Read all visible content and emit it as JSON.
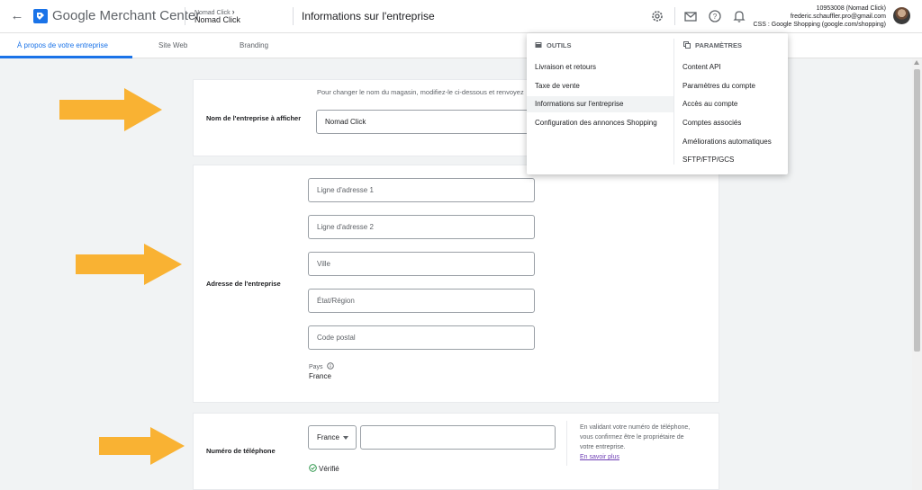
{
  "header": {
    "brand": "Google Merchant Center",
    "account_breadcrumb": "Nomad Click",
    "account_name": "Nomad Click",
    "page_title": "Informations sur l'entreprise",
    "user_id_line": "10953008 (Nomad Click)",
    "user_email": "frederic.schauffler.pro@gmail.com",
    "user_css": "CSS : Google Shopping (google.com/shopping)"
  },
  "tabs": [
    {
      "label": "À propos de votre entreprise",
      "active": true
    },
    {
      "label": "Site Web",
      "active": false
    },
    {
      "label": "Branding",
      "active": false
    }
  ],
  "business_name": {
    "label": "Nom de l'entreprise à afficher",
    "hint": "Pour changer le nom du magasin, modifiez-le ci-dessous et renvoyez",
    "value": "Nomad Click"
  },
  "address": {
    "label": "Adresse de l'entreprise",
    "line1_placeholder": "Ligne d'adresse 1",
    "line2_placeholder": "Ligne d'adresse 2",
    "city_placeholder": "Ville",
    "state_placeholder": "État/Région",
    "postal_placeholder": "Code postal",
    "country_label": "Pays",
    "country_value": "France"
  },
  "phone": {
    "label": "Numéro de téléphone",
    "country_select": "France",
    "verified": "Vérifié",
    "notice_line1": "En validant votre numéro de téléphone,",
    "notice_line2": "vous confirmez être le propriétaire de",
    "notice_line3": "votre entreprise.",
    "learn_more": "En savoir plus"
  },
  "menu": {
    "tools_heading": "OUTILS",
    "tools": [
      "Livraison et retours",
      "Taxe de vente",
      "Informations sur l'entreprise",
      "Configuration des annonces Shopping"
    ],
    "selected_tool": "Informations sur l'entreprise",
    "settings_heading": "PARAMÈTRES",
    "settings": [
      "Content API",
      "Paramètres du compte",
      "Accès au compte",
      "Comptes associés",
      "Améliorations automatiques",
      "SFTP/FTP/GCS"
    ]
  },
  "colors": {
    "accent": "#1a73e8",
    "arrow": "#f9b233",
    "verified": "#1e8e3e",
    "link": "#6f3fb5"
  }
}
